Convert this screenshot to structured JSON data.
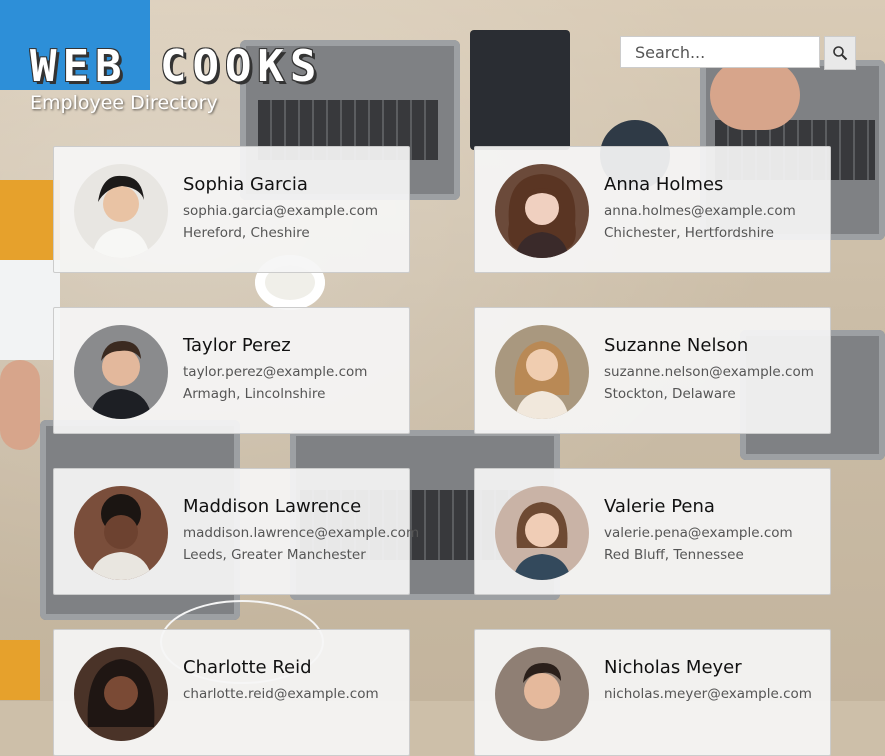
{
  "header": {
    "logo": "WEB COOKS",
    "subtitle": "Employee Directory"
  },
  "search": {
    "placeholder": "Search...",
    "button_icon": "search-icon"
  },
  "employees": [
    {
      "name": "Sophia Garcia",
      "email": "sophia.garcia@example.com",
      "location": "Hereford, Cheshire",
      "avatar_color": "#e8e6e2"
    },
    {
      "name": "Anna Holmes",
      "email": "anna.holmes@example.com",
      "location": "Chichester, Hertfordshire",
      "avatar_color": "#6b4a3a"
    },
    {
      "name": "Taylor Perez",
      "email": "taylor.perez@example.com",
      "location": "Armagh, Lincolnshire",
      "avatar_color": "#8a8b8d"
    },
    {
      "name": "Suzanne Nelson",
      "email": "suzanne.nelson@example.com",
      "location": "Stockton, Delaware",
      "avatar_color": "#a9987f"
    },
    {
      "name": "Maddison Lawrence",
      "email": "maddison.lawrence@example.com",
      "location": "Leeds, Greater Manchester",
      "avatar_color": "#7a4e3b"
    },
    {
      "name": "Valerie Pena",
      "email": "valerie.pena@example.com",
      "location": "Red Bluff, Tennessee",
      "avatar_color": "#c9b3a6"
    },
    {
      "name": "Charlotte Reid",
      "email": "charlotte.reid@example.com",
      "location": "",
      "avatar_color": "#4a3328"
    },
    {
      "name": "Nicholas Meyer",
      "email": "nicholas.meyer@example.com",
      "location": "",
      "avatar_color": "#8f7f74"
    }
  ]
}
